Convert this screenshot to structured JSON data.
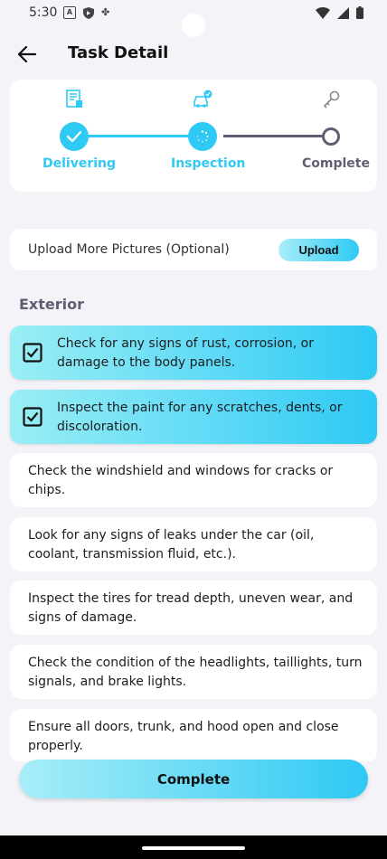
{
  "status_bar": {
    "time": "5:30",
    "left_icons": [
      "a-box-icon",
      "shield-icon",
      "fan-icon"
    ],
    "right_icons": [
      "wifi-icon",
      "signal-icon",
      "battery-icon"
    ]
  },
  "app_bar": {
    "title": "Task Detail",
    "back_icon": "back-arrow-icon"
  },
  "stepper": {
    "steps": [
      {
        "label": "Delivering",
        "icon": "document-icon",
        "state": "done"
      },
      {
        "label": "Inspection",
        "icon": "car-check-icon",
        "state": "active"
      },
      {
        "label": "Complete",
        "icon": "key-icon",
        "state": "pending"
      }
    ]
  },
  "upload": {
    "label": "Upload More Pictures (Optional)",
    "button": "Upload"
  },
  "section": {
    "title": "Exterior"
  },
  "checklist": [
    {
      "text": "Check for any signs of rust, corrosion, or damage to the body panels.",
      "checked": true
    },
    {
      "text": "Inspect the paint for any scratches, dents, or discoloration.",
      "checked": true
    },
    {
      "text": "Check the windshield and windows for cracks or chips.",
      "checked": false
    },
    {
      "text": "Look for any signs of leaks under the car (oil, coolant, transmission fluid, etc.).",
      "checked": false
    },
    {
      "text": "Inspect the tires for tread depth, uneven wear, and signs of damage.",
      "checked": false
    },
    {
      "text": "Check the condition of the headlights, taillights, turn signals, and brake lights.",
      "checked": false
    },
    {
      "text": "Ensure all doors, trunk, and hood open and close properly.",
      "checked": false
    }
  ],
  "footer": {
    "button": "Complete"
  },
  "colors": {
    "accent": "#2ec9f4",
    "accent_light": "#a8eef8",
    "muted": "#5f5f72",
    "background": "#f4f3f7"
  }
}
